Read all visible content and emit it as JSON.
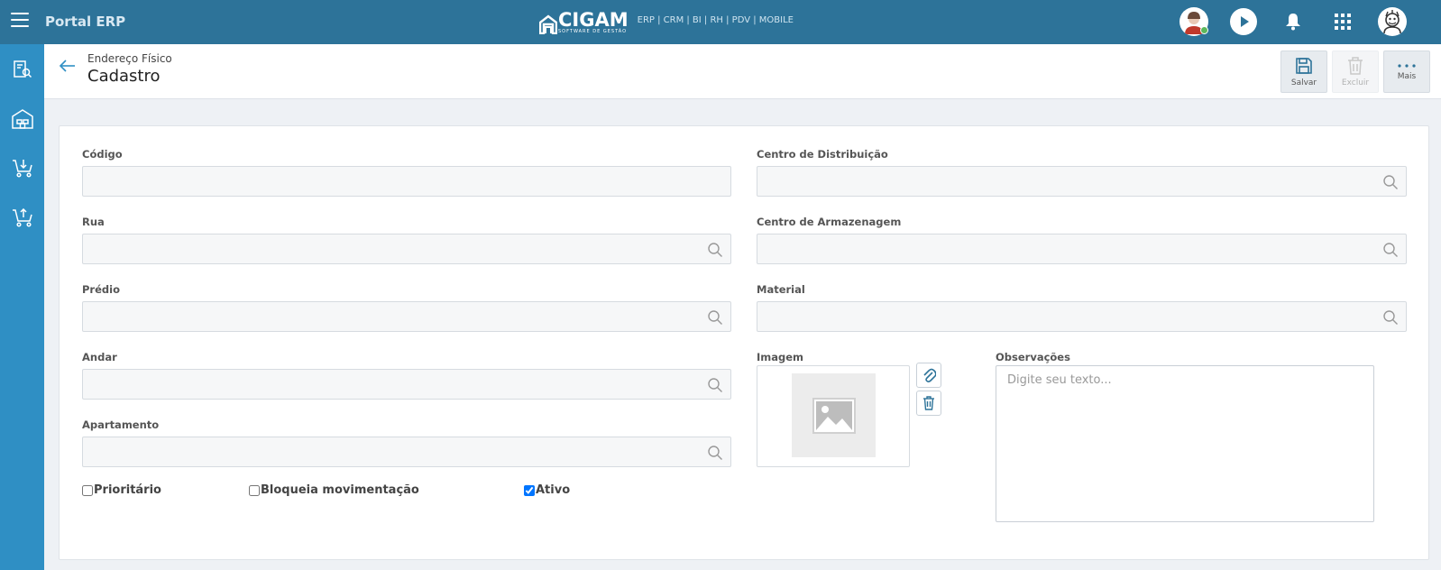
{
  "app": {
    "title": "Portal ERP",
    "brand_name": "CIGAM",
    "brand_subtitle": "SOFTWARE DE GESTÃO",
    "brand_modules": "ERP | CRM | BI | RH | PDV | MOBILE"
  },
  "header": {
    "breadcrumb": "Endereço Físico",
    "title": "Cadastro"
  },
  "toolbar": {
    "save_label": "Salvar",
    "delete_label": "Excluir",
    "more_label": "Mais"
  },
  "form": {
    "codigo_label": "Código",
    "codigo_value": "",
    "rua_label": "Rua",
    "rua_value": "",
    "predio_label": "Prédio",
    "predio_value": "",
    "andar_label": "Andar",
    "andar_value": "",
    "apartamento_label": "Apartamento",
    "apartamento_value": "",
    "centro_distribuicao_label": "Centro de Distribuição",
    "centro_distribuicao_value": "",
    "centro_armazenagem_label": "Centro de Armazenagem",
    "centro_armazenagem_value": "",
    "material_label": "Material",
    "material_value": "",
    "imagem_label": "Imagem",
    "observacoes_label": "Observações",
    "observacoes_placeholder": "Digite seu texto...",
    "prioritario_label": "Prioritário",
    "prioritario_checked": false,
    "bloqueia_label": "Bloqueia movimentação",
    "bloqueia_checked": false,
    "ativo_label": "Ativo",
    "ativo_checked": true
  },
  "colors": {
    "topbar": "#2d7399",
    "sidebar": "#2f8fc4",
    "accent": "#2f8fc4"
  }
}
